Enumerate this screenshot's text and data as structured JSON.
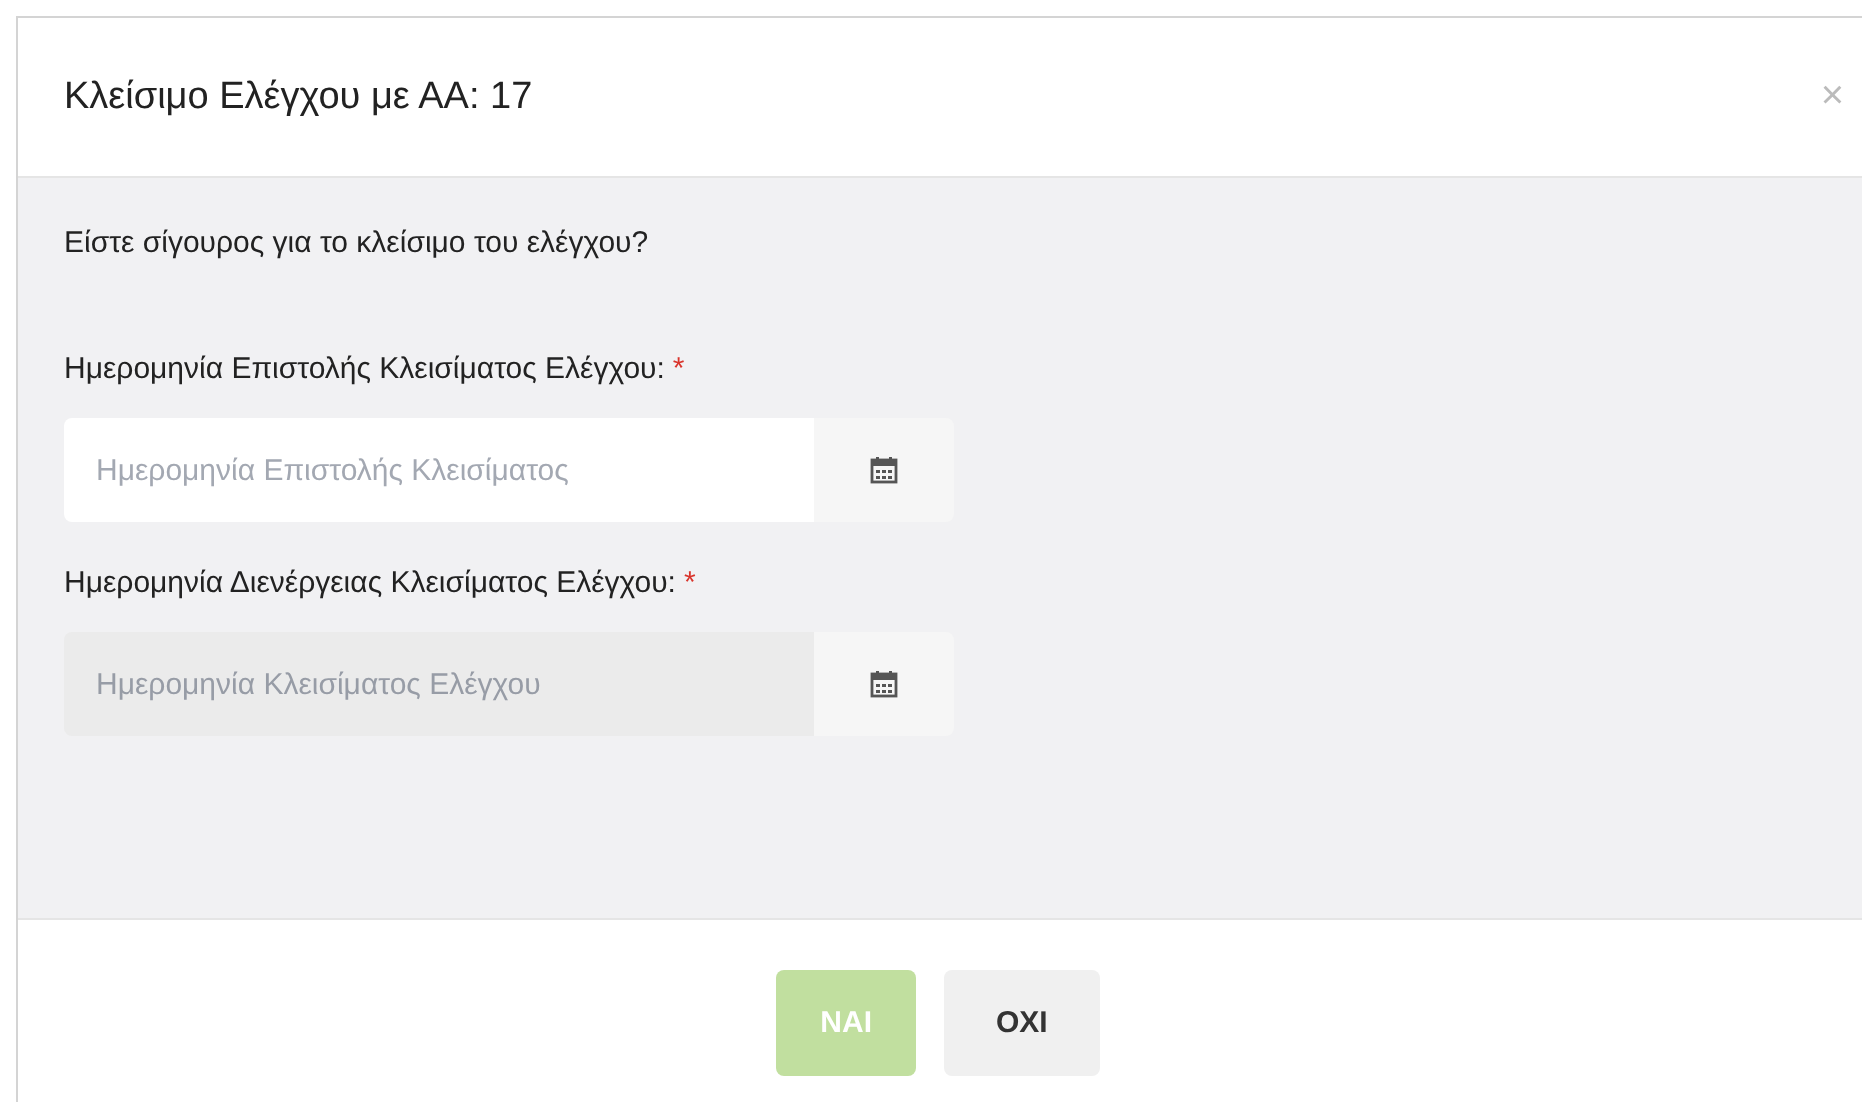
{
  "dialog": {
    "title": "Κλείσιμο Ελέγχου με ΑΑ: 17",
    "close": "×"
  },
  "question": "Είστε σίγουρος για το κλείσιμο του ελέγχου?",
  "fields": [
    {
      "label": "Ημερομηνία Επιστολής Κλεισίματος Ελέγχου:",
      "required": "*",
      "placeholder": "Ημερομηνία Επιστολής Κλεισίματος",
      "disabled": false
    },
    {
      "label": "Ημερομηνία Διενέργειας Κλεισίματος Ελέγχου:",
      "required": "*",
      "placeholder": "Ημερομηνία Κλεισίματος Ελέγχου",
      "disabled": true
    }
  ],
  "buttons": [
    {
      "label": "ΝΑΙ",
      "kind": "primary",
      "disabled": true
    },
    {
      "label": "ΟΧΙ",
      "kind": "default",
      "disabled": false
    }
  ]
}
